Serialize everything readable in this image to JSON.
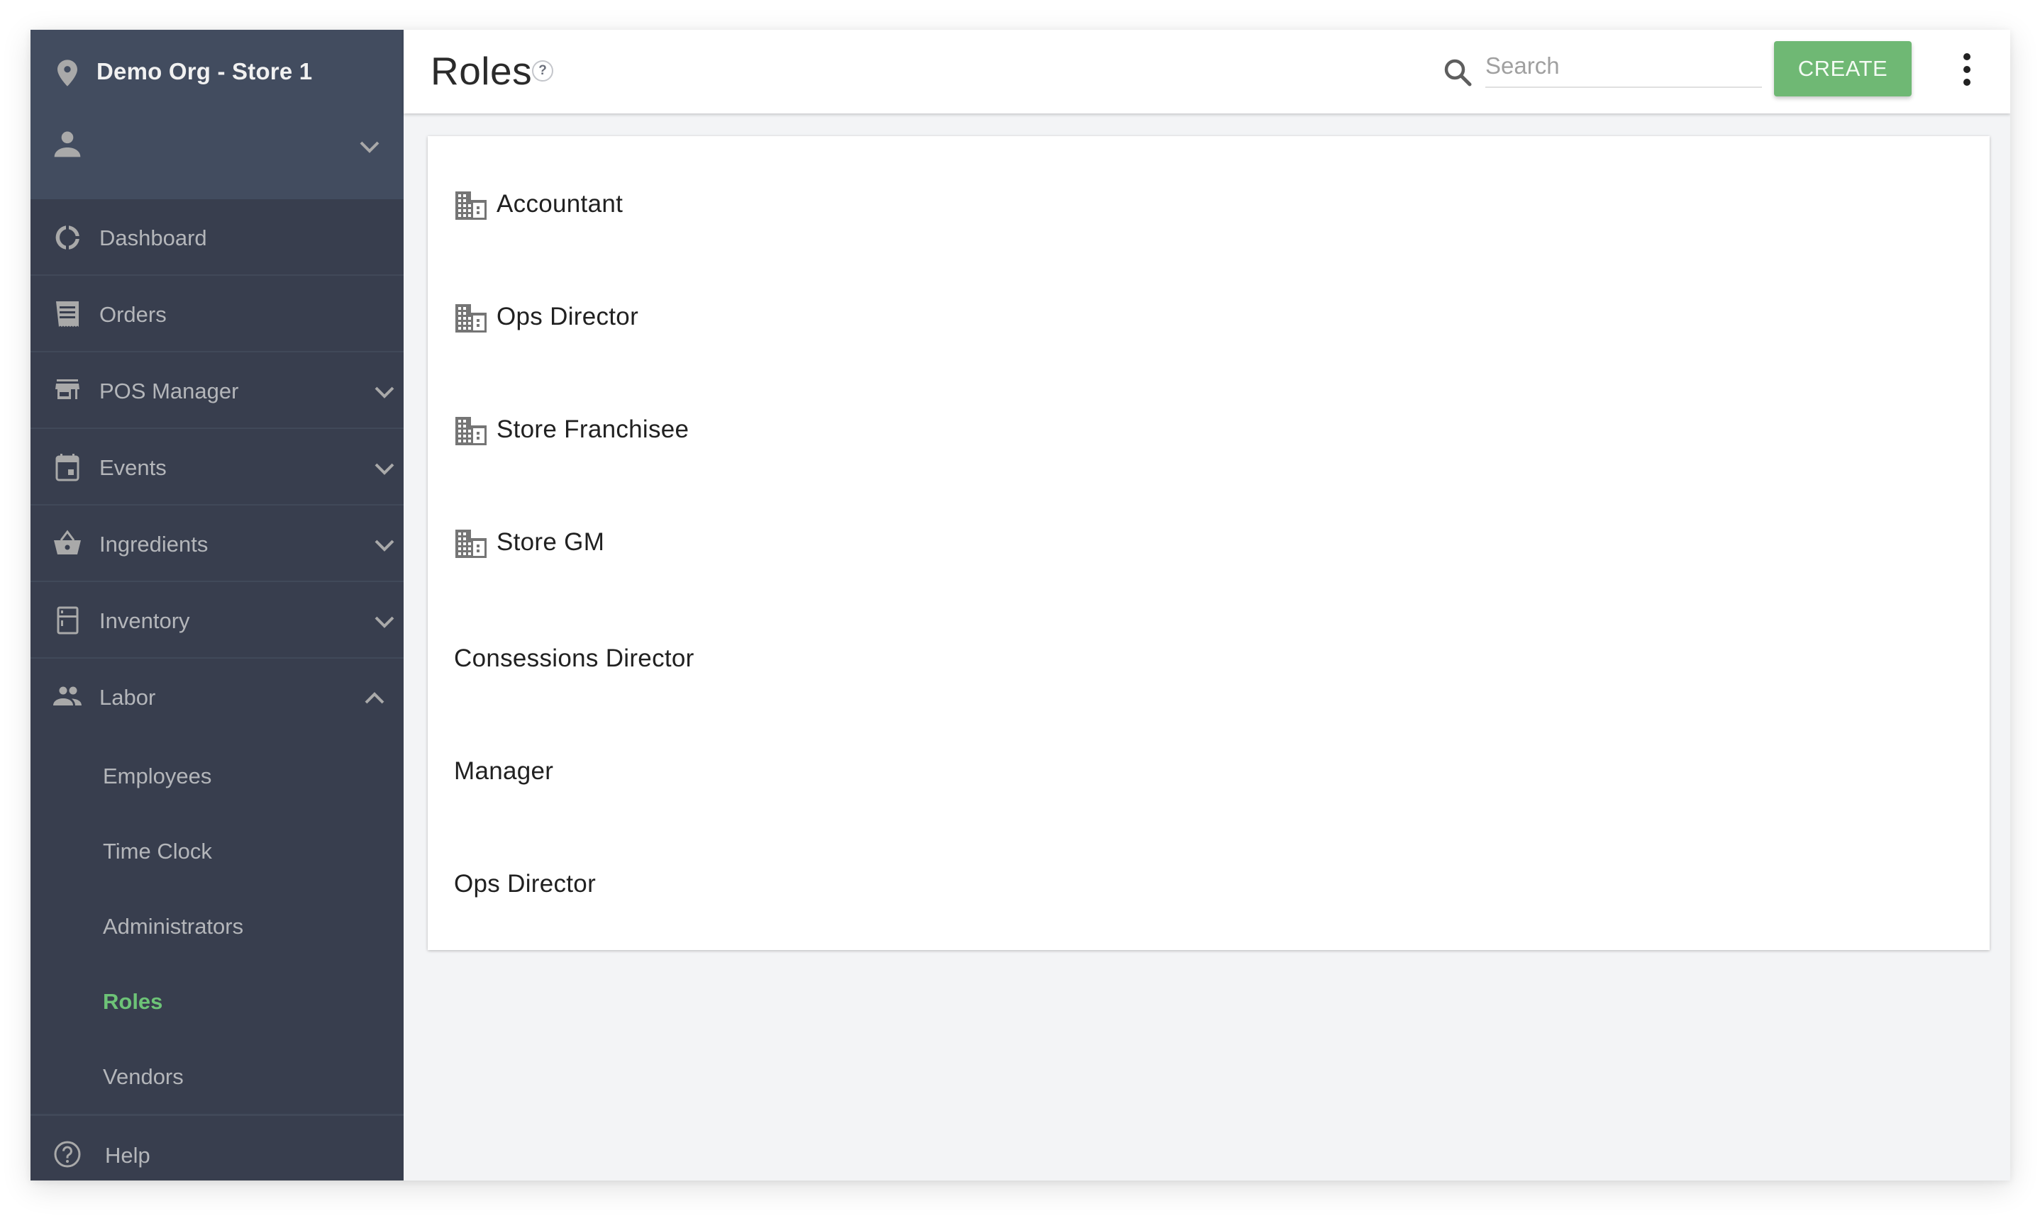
{
  "sidebar": {
    "org_name": "Demo Org - Store 1",
    "org_icon": "map-pin-icon",
    "user_icon": "person-icon",
    "nav": [
      {
        "label": "Dashboard",
        "icon": "dashboard-donut-icon",
        "expandable": false
      },
      {
        "label": "Orders",
        "icon": "receipt-icon",
        "expandable": false
      },
      {
        "label": "POS Manager",
        "icon": "storefront-icon",
        "expandable": true,
        "expanded": false
      },
      {
        "label": "Events",
        "icon": "calendar-icon",
        "expandable": true,
        "expanded": false
      },
      {
        "label": "Ingredients",
        "icon": "basket-icon",
        "expandable": true,
        "expanded": false
      },
      {
        "label": "Inventory",
        "icon": "kitchen-fridge-icon",
        "expandable": true,
        "expanded": false
      },
      {
        "label": "Labor",
        "icon": "people-icon",
        "expandable": true,
        "expanded": true
      }
    ],
    "labor_sub": [
      {
        "label": "Employees",
        "active": false
      },
      {
        "label": "Time Clock",
        "active": false
      },
      {
        "label": "Administrators",
        "active": false
      },
      {
        "label": "Roles",
        "active": true
      },
      {
        "label": "Vendors",
        "active": false
      }
    ],
    "help": {
      "label": "Help",
      "icon": "help-circle-icon"
    }
  },
  "header": {
    "title": "Roles",
    "help_badge": "?",
    "search": {
      "placeholder": "Search",
      "value": ""
    },
    "create_label": "CREATE",
    "more_icon": "more-vert-icon"
  },
  "roles": [
    {
      "name": "Accountant",
      "icon": "building-icon"
    },
    {
      "name": "Ops Director",
      "icon": "building-icon"
    },
    {
      "name": "Store Franchisee",
      "icon": "building-icon"
    },
    {
      "name": "Store GM",
      "icon": "building-icon"
    },
    {
      "name": "Consessions Director",
      "icon": null
    },
    {
      "name": "Manager",
      "icon": null
    },
    {
      "name": "Ops Director",
      "icon": null
    }
  ],
  "colors": {
    "sidebar_header": "#424c5f",
    "sidebar_bg": "#383e4e",
    "sidebar_text": "#b4b6ba",
    "active_green": "#6dc377",
    "create_button": "#6fb874",
    "content_bg": "#f3f4f6"
  }
}
